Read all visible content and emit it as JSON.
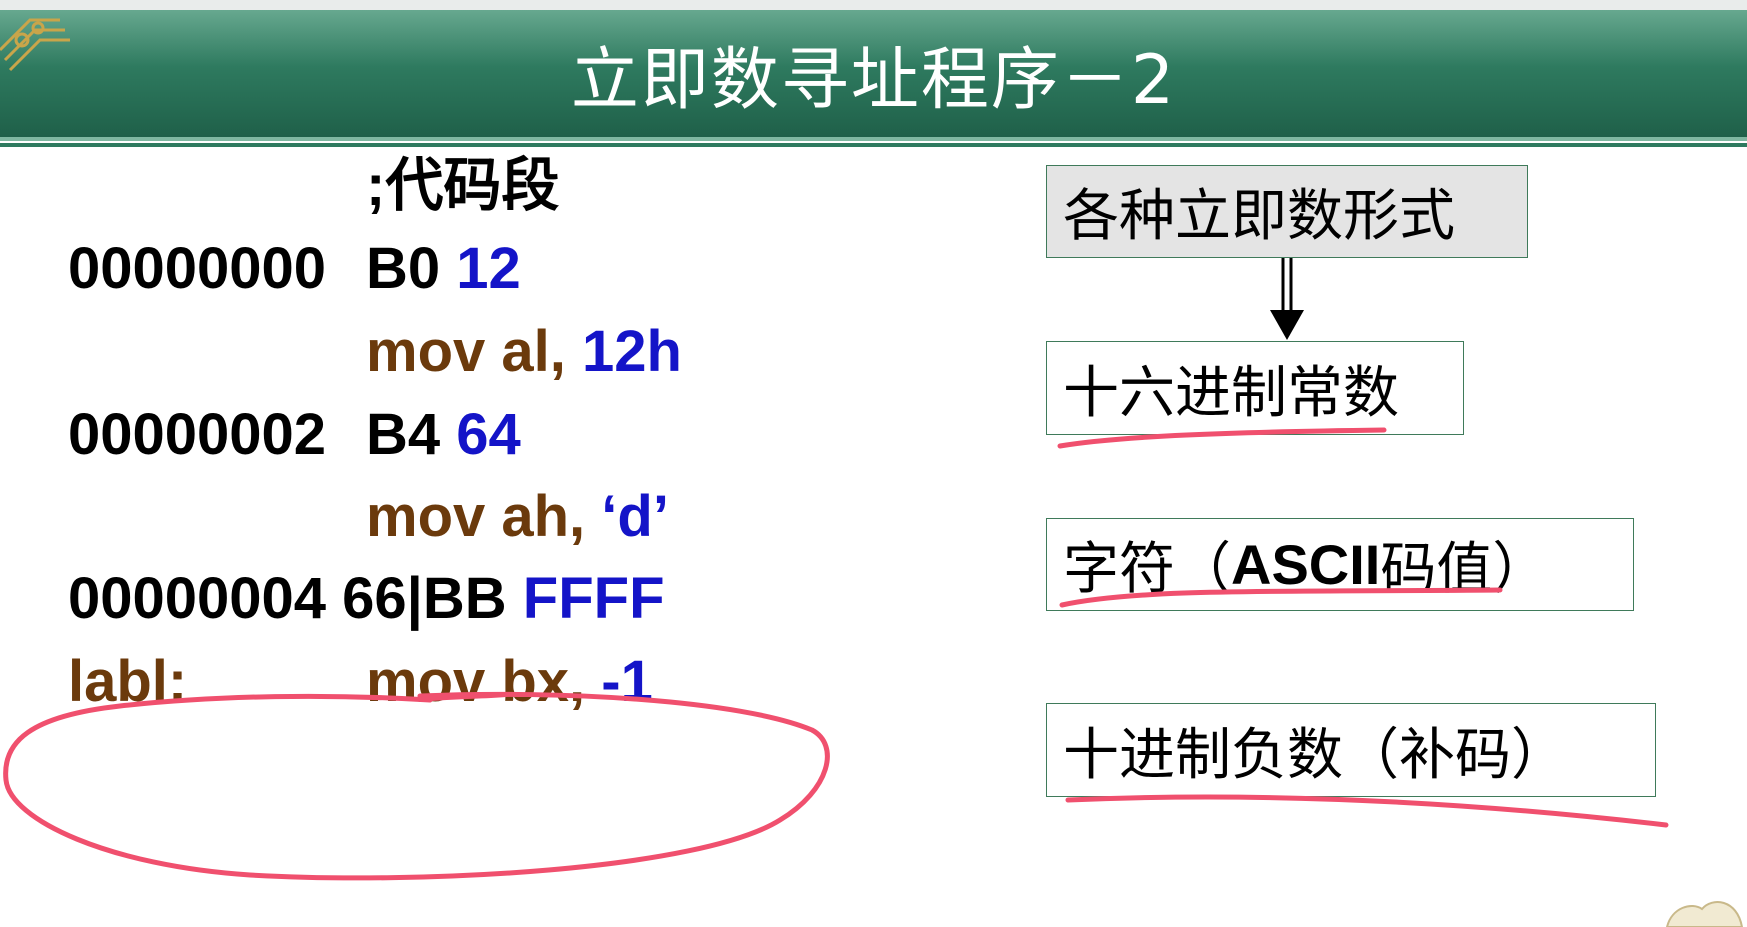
{
  "slide": {
    "title": "立即数寻址程序－2"
  },
  "code": {
    "comment": ";代码段",
    "line1": {
      "addr": "00000000",
      "bytes_op": "B0 ",
      "bytes_imm": "12"
    },
    "line2": {
      "instr": "mov al, ",
      "operand": "12h"
    },
    "line3": {
      "addr": "00000002",
      "bytes_op": "B4 ",
      "bytes_imm": "64"
    },
    "line4": {
      "instr": "mov ah, ",
      "operand": "‘d’"
    },
    "line5": {
      "addr_bytes": "00000004 66|BB ",
      "bytes_imm": "FFFF"
    },
    "line6": {
      "label": "labl:",
      "instr": "mov bx, ",
      "operand": "-1"
    }
  },
  "diagram": {
    "header_box": "各种立即数形式",
    "box_hex": "十六进制常数",
    "box_char_prefix": "字符（",
    "box_char_ascii": "ASCII",
    "box_char_suffix": "码值）",
    "box_neg": "十进制负数（补码）"
  },
  "colors": {
    "title_bar": "#2e7a5f",
    "code_text": "#000000",
    "instruction": "#6b3a0c",
    "immediate": "#1414c8",
    "annotation_ink": "#f0506e"
  }
}
